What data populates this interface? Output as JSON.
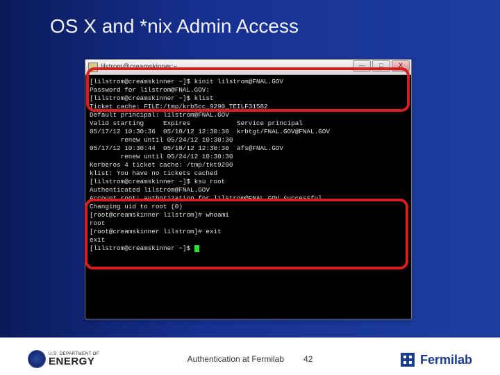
{
  "slide": {
    "title": "OS X and *nix Admin Access"
  },
  "window": {
    "title": "lilstrom@creamskinner:~",
    "controls": {
      "min": "—",
      "max": "□",
      "close": "X"
    }
  },
  "terminal": {
    "lines": [
      "[lilstrom@creamskinner ~]$ kinit lilstrom@FNAL.GOV",
      "Password for lilstrom@FNAL.GOV:",
      "[lilstrom@creamskinner ~]$ klist",
      "Ticket cache: FILE:/tmp/krb5cc_9290_TEILF31582",
      "Default principal: lilstrom@FNAL.GOV",
      "",
      "Valid starting     Expires            Service principal",
      "05/17/12 10:30:36  05/18/12 12:30:30  krbtgt/FNAL.GOV@FNAL.GOV",
      "        renew until 05/24/12 10:30:30",
      "05/17/12 10:30:44  05/18/12 12:30:30  afs@FNAL.GOV",
      "        renew until 05/24/12 10:30:30",
      "",
      "",
      "Kerberos 4 ticket cache: /tmp/tkt9290",
      "klist: You have no tickets cached",
      "[lilstrom@creamskinner ~]$ ksu root",
      "Authenticated lilstrom@FNAL.GOV",
      "Account root: authorization for lilstrom@FNAL.GOV successful",
      "Changing uid to root (0)",
      "[root@creamskinner lilstrom]# whoami",
      "root",
      "[root@creamskinner lilstrom]# exit",
      "exit",
      "[lilstrom@creamskinner ~]$ "
    ]
  },
  "footer": {
    "doe_small": "U.S. DEPARTMENT OF",
    "doe_big": "ENERGY",
    "caption": "Authentication at Fermilab",
    "page": "42",
    "fermi": "Fermilab"
  }
}
